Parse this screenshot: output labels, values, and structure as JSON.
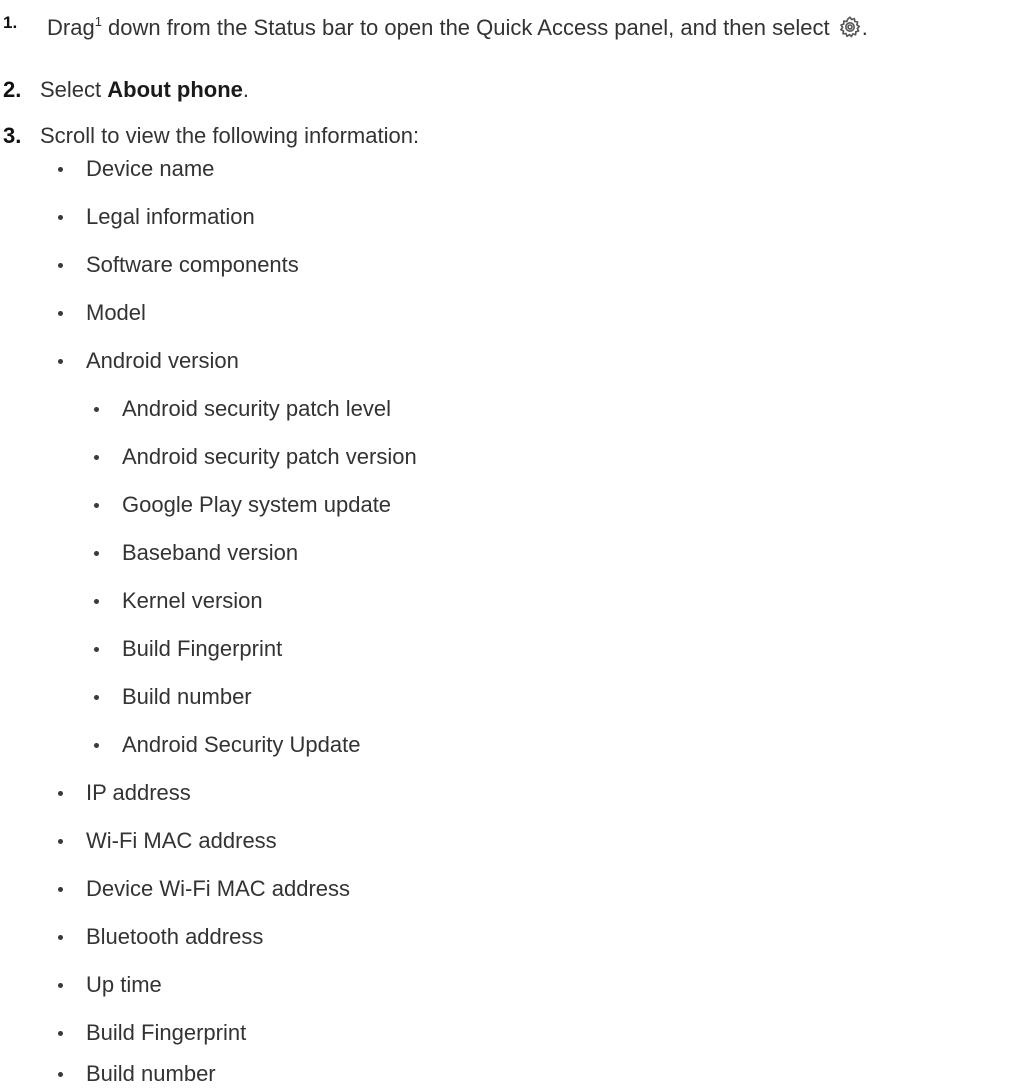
{
  "steps": [
    {
      "num": "1.",
      "text_before": "Drag",
      "superscript": "1",
      "text_after": " down from the Status bar to open the Quick Access panel, and then select ",
      "icon": "settings-gear-icon",
      "text_end": "."
    },
    {
      "num": "2.",
      "text_before": "Select ",
      "bold": "About phone",
      "text_after": "."
    },
    {
      "num": "3.",
      "text": "Scroll to view the following information:"
    }
  ],
  "info_items": [
    {
      "label": "Device name",
      "level": 1
    },
    {
      "label": "Legal information",
      "level": 1
    },
    {
      "label": "Software components",
      "level": 1
    },
    {
      "label": "Model",
      "level": 1
    },
    {
      "label": "Android version",
      "level": 1
    },
    {
      "label": "Android security patch level",
      "level": 2
    },
    {
      "label": "Android security patch version",
      "level": 2
    },
    {
      "label": "Google Play system update",
      "level": 2
    },
    {
      "label": "Baseband version",
      "level": 2
    },
    {
      "label": "Kernel version",
      "level": 2
    },
    {
      "label": "Build Fingerprint",
      "level": 2
    },
    {
      "label": "Build number",
      "level": 2
    },
    {
      "label": "Android Security Update",
      "level": 2
    },
    {
      "label": "IP address",
      "level": 1
    },
    {
      "label": "Wi-Fi MAC address",
      "level": 1
    },
    {
      "label": "Device Wi-Fi MAC address",
      "level": 1
    },
    {
      "label": "Bluetooth address",
      "level": 1
    },
    {
      "label": "Up time",
      "level": 1
    },
    {
      "label": "Build Fingerprint",
      "level": 1
    },
    {
      "label": "Build number",
      "level": 1
    }
  ]
}
